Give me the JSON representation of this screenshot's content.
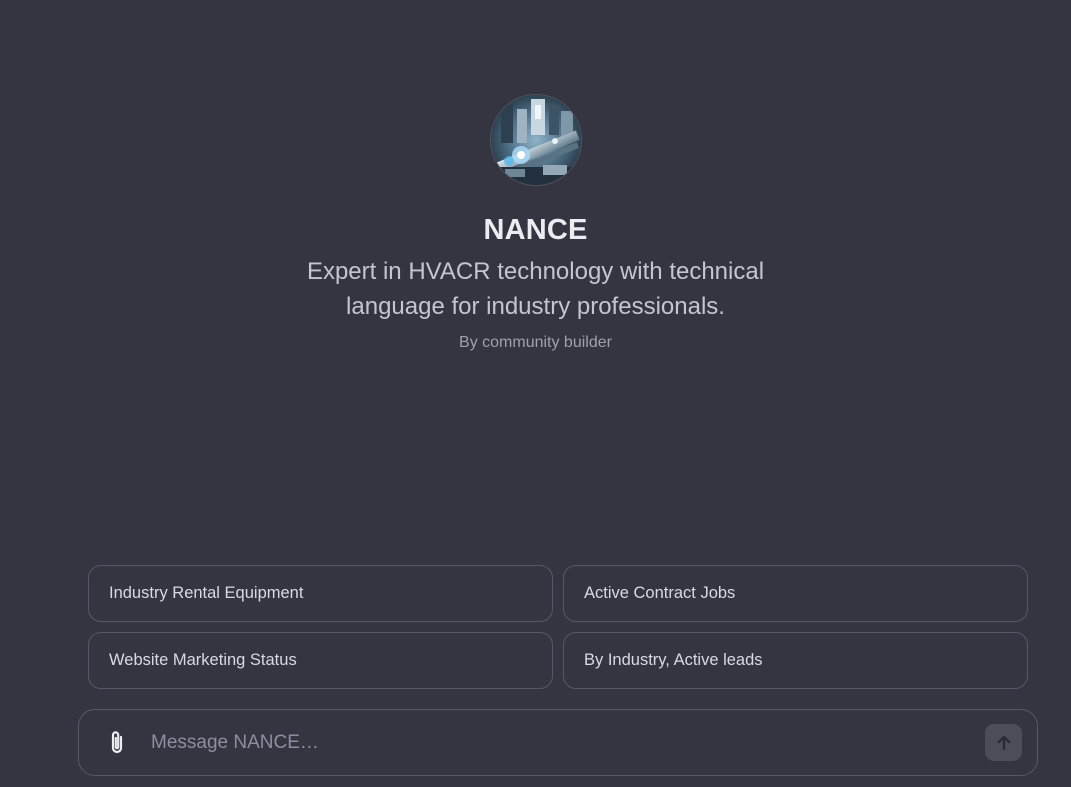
{
  "gpt": {
    "name": "NANCE",
    "description": "Expert in HVACR technology with technical language for industry professionals.",
    "author": "By community builder",
    "avatar": "hvac-machinery-illustration"
  },
  "suggestions": [
    {
      "label": "Industry Rental Equipment"
    },
    {
      "label": "Active Contract Jobs"
    },
    {
      "label": "Website Marketing Status"
    },
    {
      "label": "By Industry, Active leads"
    }
  ],
  "composer": {
    "placeholder": "Message NANCE…",
    "attach_icon": "paperclip-icon",
    "send_icon": "arrow-up-icon"
  },
  "colors": {
    "background": "#343541",
    "border": "#565869",
    "send_button": "#4c4d59"
  }
}
